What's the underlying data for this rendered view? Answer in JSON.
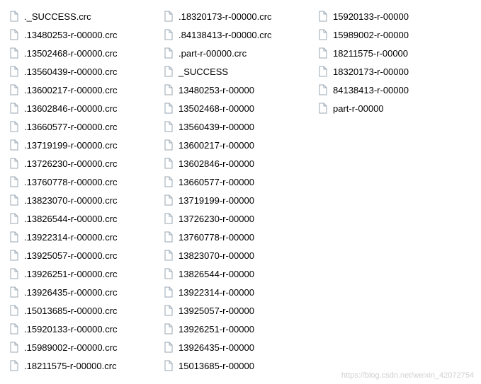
{
  "watermark": "https://blog.csdn.net/weixin_42072754",
  "files": [
    {
      "name": "._SUCCESS.crc"
    },
    {
      "name": ".13480253-r-00000.crc"
    },
    {
      "name": ".13502468-r-00000.crc"
    },
    {
      "name": ".13560439-r-00000.crc"
    },
    {
      "name": ".13600217-r-00000.crc"
    },
    {
      "name": ".13602846-r-00000.crc"
    },
    {
      "name": ".13660577-r-00000.crc"
    },
    {
      "name": ".13719199-r-00000.crc"
    },
    {
      "name": ".13726230-r-00000.crc"
    },
    {
      "name": ".13760778-r-00000.crc"
    },
    {
      "name": ".13823070-r-00000.crc"
    },
    {
      "name": ".13826544-r-00000.crc"
    },
    {
      "name": ".13922314-r-00000.crc"
    },
    {
      "name": ".13925057-r-00000.crc"
    },
    {
      "name": ".13926251-r-00000.crc"
    },
    {
      "name": ".13926435-r-00000.crc"
    },
    {
      "name": ".15013685-r-00000.crc"
    },
    {
      "name": ".15920133-r-00000.crc"
    },
    {
      "name": ".15989002-r-00000.crc"
    },
    {
      "name": ".18211575-r-00000.crc"
    },
    {
      "name": ".18320173-r-00000.crc"
    },
    {
      "name": ".84138413-r-00000.crc"
    },
    {
      "name": ".part-r-00000.crc"
    },
    {
      "name": "_SUCCESS"
    },
    {
      "name": "13480253-r-00000"
    },
    {
      "name": "13502468-r-00000"
    },
    {
      "name": "13560439-r-00000"
    },
    {
      "name": "13600217-r-00000"
    },
    {
      "name": "13602846-r-00000"
    },
    {
      "name": "13660577-r-00000"
    },
    {
      "name": "13719199-r-00000"
    },
    {
      "name": "13726230-r-00000"
    },
    {
      "name": "13760778-r-00000"
    },
    {
      "name": "13823070-r-00000"
    },
    {
      "name": "13826544-r-00000"
    },
    {
      "name": "13922314-r-00000"
    },
    {
      "name": "13925057-r-00000"
    },
    {
      "name": "13926251-r-00000"
    },
    {
      "name": "13926435-r-00000"
    },
    {
      "name": "15013685-r-00000"
    },
    {
      "name": "15920133-r-00000"
    },
    {
      "name": "15989002-r-00000"
    },
    {
      "name": "18211575-r-00000"
    },
    {
      "name": "18320173-r-00000"
    },
    {
      "name": "84138413-r-00000"
    },
    {
      "name": "part-r-00000"
    }
  ]
}
